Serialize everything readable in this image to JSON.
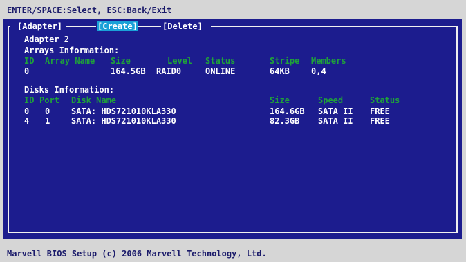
{
  "header": {
    "hint": "ENTER/SPACE:Select, ESC:Back/Exit"
  },
  "tabs": [
    {
      "label": "[Adapter]"
    },
    {
      "label": "[Create]"
    },
    {
      "label": "[Delete]"
    }
  ],
  "adapter": {
    "title": "Adapter 2"
  },
  "arrays": {
    "heading": "Arrays Information:",
    "columns": [
      "ID",
      "Array Name",
      "Size",
      "Level",
      "Status",
      "Stripe",
      "Members"
    ],
    "rows": [
      [
        "0",
        "",
        "164.5GB",
        "RAID0",
        "ONLINE",
        "64KB",
        "0,4"
      ]
    ]
  },
  "disks": {
    "heading": "Disks Information:",
    "columns": [
      "ID",
      "Port",
      "Disk Name",
      "Size",
      "Speed",
      "Status"
    ],
    "rows": [
      [
        "0",
        "0",
        "SATA: HDS721010KLA330",
        "164.6GB",
        "SATA II",
        "FREE"
      ],
      [
        "4",
        "1",
        "SATA: HDS721010KLA330",
        "82.3GB",
        "SATA II",
        "FREE"
      ]
    ]
  },
  "footer": {
    "text": "Marvell BIOS Setup (c) 2006 Marvell Technology, Ltd."
  },
  "colors": {
    "background": "#1c1c8e",
    "highlight": "#1aa1d8",
    "header_text": "#1fa23a"
  }
}
